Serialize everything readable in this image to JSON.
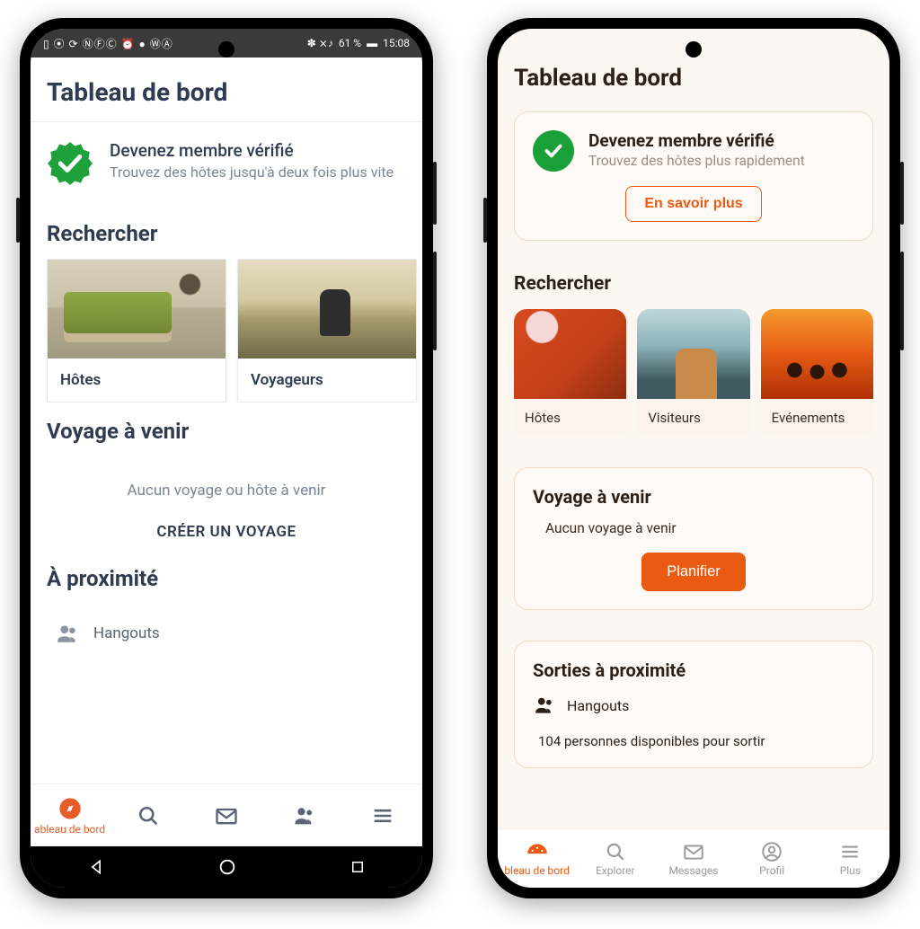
{
  "left": {
    "status": {
      "time": "15:08",
      "battery": "61 %",
      "icons_left": "▯ ⦿ ⟳ ⓃⒻⒸ ⏰ ● ⓌⒶ",
      "icons_right": "✽  ⨯♪"
    },
    "title": "Tableau de bord",
    "verify": {
      "title": "Devenez membre vérifié",
      "sub": "Trouvez des hôtes jusqu'à deux fois plus vite"
    },
    "search_heading": "Rechercher",
    "cards": [
      {
        "label": "Hôtes"
      },
      {
        "label": "Voyageurs"
      }
    ],
    "trip_heading": "Voyage à venir",
    "trip_empty": "Aucun voyage ou hôte à venir",
    "trip_create": "CRÉER UN VOYAGE",
    "nearby_heading": "À proximité",
    "hangouts_label": "Hangouts",
    "nav": {
      "dashboard": "ableau de bord"
    }
  },
  "right": {
    "title": "Tableau de bord",
    "verify": {
      "title": "Devenez membre vérifié",
      "sub": "Trouvez des hôtes plus rapidement",
      "button": "En savoir plus"
    },
    "search_heading": "Rechercher",
    "cards": [
      {
        "label": "Hôtes"
      },
      {
        "label": "Visiteurs"
      },
      {
        "label": "Evénements"
      }
    ],
    "trip": {
      "heading": "Voyage à venir",
      "empty": "Aucun voyage à venir",
      "button": "Planifier"
    },
    "outings": {
      "heading": "Sorties à proximité",
      "hangouts": "Hangouts",
      "sub": "104 personnes disponibles pour sortir"
    },
    "nav": {
      "dashboard": "bleau de bord",
      "explore": "Explorer",
      "messages": "Messages",
      "profile": "Profil",
      "more": "Plus"
    }
  }
}
